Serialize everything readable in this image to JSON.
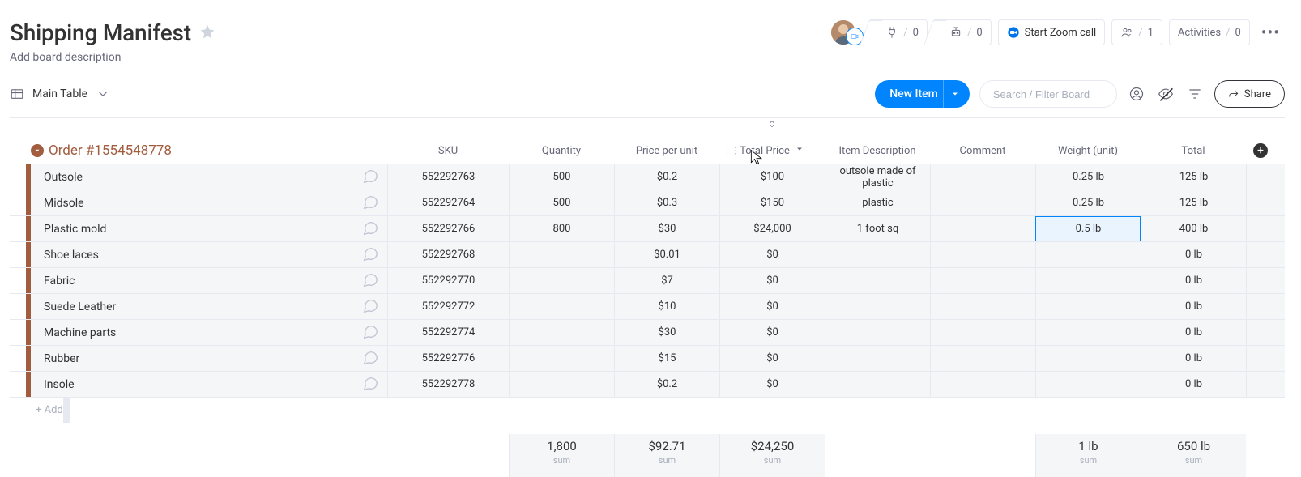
{
  "header": {
    "title": "Shipping Manifest",
    "subtitle": "Add board description",
    "integrations_count": "0",
    "automations_count": "0",
    "zoom_label": "Start Zoom call",
    "members_count": "1",
    "activities_label": "Activities",
    "activities_count": "0"
  },
  "toolbar": {
    "view_label": "Main Table",
    "new_item_label": "New Item",
    "search_placeholder": "Search / Filter Board",
    "share_label": "Share"
  },
  "group": {
    "title": "Order #1554548778",
    "color": "#a25c3e",
    "add_row_label": "+ Add"
  },
  "columns": [
    "SKU",
    "Quantity",
    "Price per unit",
    "Total Price",
    "Item Description",
    "Comment",
    "Weight (unit)",
    "Total"
  ],
  "sorted_column_index": 3,
  "highlighted_cell": {
    "row_index": 2,
    "col_index": 6
  },
  "rows": [
    {
      "name": "Outsole",
      "sku": "552292763",
      "qty": "500",
      "ppu": "$0.2",
      "total_price": "$100",
      "desc": "outsole made of plastic",
      "comment": "",
      "weight": "0.25 lb",
      "total": "125 lb"
    },
    {
      "name": "Midsole",
      "sku": "552292764",
      "qty": "500",
      "ppu": "$0.3",
      "total_price": "$150",
      "desc": "plastic",
      "comment": "",
      "weight": "0.25 lb",
      "total": "125 lb"
    },
    {
      "name": "Plastic mold",
      "sku": "552292766",
      "qty": "800",
      "ppu": "$30",
      "total_price": "$24,000",
      "desc": "1 foot sq",
      "comment": "",
      "weight": "0.5 lb",
      "total": "400 lb"
    },
    {
      "name": "Shoe laces",
      "sku": "552292768",
      "qty": "",
      "ppu": "$0.01",
      "total_price": "$0",
      "desc": "",
      "comment": "",
      "weight": "",
      "total": "0 lb"
    },
    {
      "name": "Fabric",
      "sku": "552292770",
      "qty": "",
      "ppu": "$7",
      "total_price": "$0",
      "desc": "",
      "comment": "",
      "weight": "",
      "total": "0 lb"
    },
    {
      "name": "Suede Leather",
      "sku": "552292772",
      "qty": "",
      "ppu": "$10",
      "total_price": "$0",
      "desc": "",
      "comment": "",
      "weight": "",
      "total": "0 lb"
    },
    {
      "name": "Machine parts",
      "sku": "552292774",
      "qty": "",
      "ppu": "$30",
      "total_price": "$0",
      "desc": "",
      "comment": "",
      "weight": "",
      "total": "0 lb"
    },
    {
      "name": "Rubber",
      "sku": "552292776",
      "qty": "",
      "ppu": "$15",
      "total_price": "$0",
      "desc": "",
      "comment": "",
      "weight": "",
      "total": "0 lb"
    },
    {
      "name": "Insole",
      "sku": "552292778",
      "qty": "",
      "ppu": "$0.2",
      "total_price": "$0",
      "desc": "",
      "comment": "",
      "weight": "",
      "total": "0 lb"
    }
  ],
  "summary": {
    "label": "sum",
    "qty": "1,800",
    "ppu": "$92.71",
    "total_price": "$24,250",
    "weight": "1 lb",
    "total": "650 lb"
  }
}
